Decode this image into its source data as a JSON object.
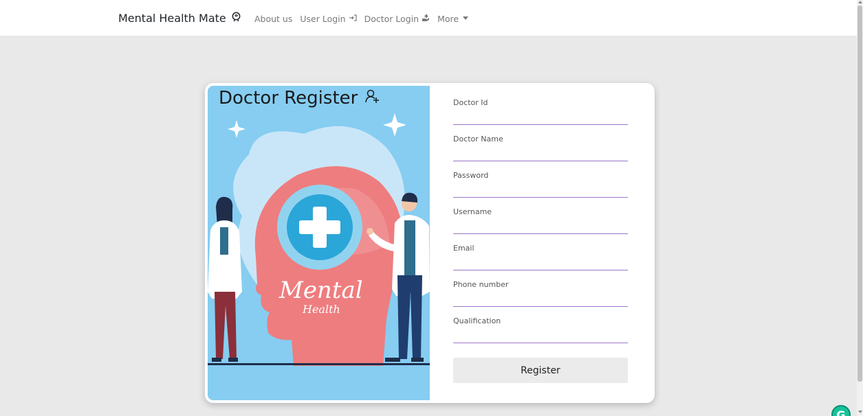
{
  "navbar": {
    "brand": "Mental Health Mate",
    "links": [
      {
        "label": "About us"
      },
      {
        "label": "User Login"
      },
      {
        "label": "Doctor Login"
      },
      {
        "label": "More"
      }
    ]
  },
  "card": {
    "title": "Doctor Register",
    "illustration": {
      "text_main": "Mental",
      "text_sub": "Health"
    }
  },
  "form": {
    "fields": [
      {
        "label": "Doctor Id",
        "value": ""
      },
      {
        "label": "Doctor Name",
        "value": ""
      },
      {
        "label": "Password",
        "value": ""
      },
      {
        "label": "Username",
        "value": ""
      },
      {
        "label": "Email",
        "value": ""
      },
      {
        "label": "Phone number",
        "value": ""
      },
      {
        "label": "Qualification",
        "value": ""
      }
    ],
    "submit_label": "Register"
  },
  "colors": {
    "page_bg": "#e9e9e9",
    "illustration_bg": "#86cdf1",
    "input_underline": "#9b74c9",
    "head_pink": "#ee7d7f",
    "cross_circle": "#2ba6d8"
  },
  "icons": {
    "brand": "brain-head-icon",
    "user_login": "sign-in-icon",
    "doctor_login": "hand-holding-medical-icon",
    "more": "caret-down-icon",
    "title": "add-user-icon"
  }
}
